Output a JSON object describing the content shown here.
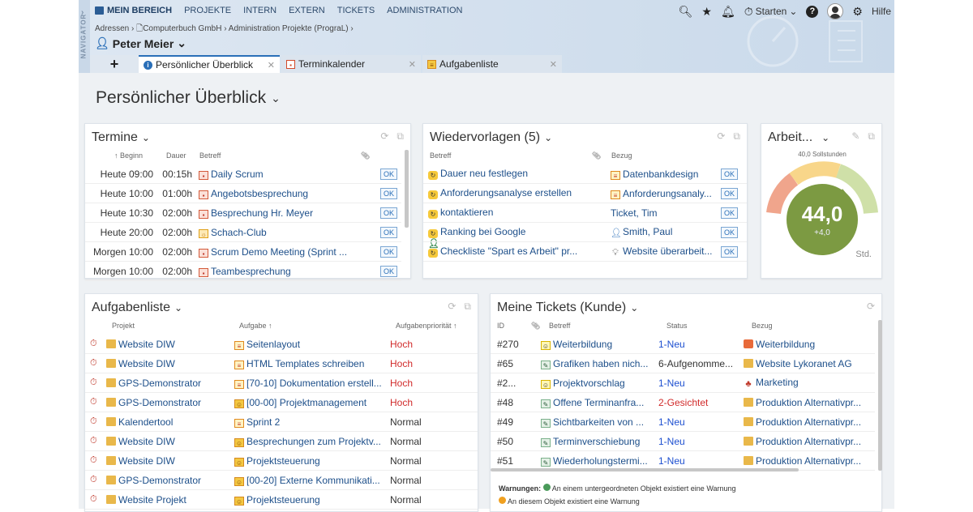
{
  "nav": {
    "vertical_label": "NAVIGATOR",
    "items": [
      "MEIN BEREICH",
      "PROJEKTE",
      "INTERN",
      "EXTERN",
      "TICKETS",
      "ADMINISTRATION"
    ]
  },
  "topright": {
    "start_label": "Starten",
    "help_label": "Hilfe"
  },
  "breadcrumb": [
    "Adressen",
    "Computerbuch GmbH",
    "Administration Projekte (PrograL)"
  ],
  "user": {
    "name": "Peter Meier"
  },
  "tabs": [
    {
      "label": "Persönlicher Überblick",
      "icon": "info-icon"
    },
    {
      "label": "Terminkalender",
      "icon": "calendar-icon"
    },
    {
      "label": "Aufgabenliste",
      "icon": "task-icon"
    }
  ],
  "page_title": "Persönlicher Überblick",
  "termine": {
    "title": "Termine",
    "headers": [
      "↑ Beginn",
      "Dauer",
      "Betreff"
    ],
    "rows": [
      {
        "begin": "Heute 09:00",
        "dauer": "00:15h",
        "betreff": "Daily Scrum",
        "icon": "cal",
        "ok": "OK"
      },
      {
        "begin": "Heute 10:00",
        "dauer": "01:00h",
        "betreff": "Angebotsbesprechung",
        "icon": "cal",
        "ok": "OK"
      },
      {
        "begin": "Heute 10:30",
        "dauer": "02:00h",
        "betreff": "Besprechung Hr. Meyer",
        "icon": "cal",
        "ok": "OK"
      },
      {
        "begin": "Heute 20:00",
        "dauer": "02:00h",
        "betreff": "Schach-Club",
        "icon": "club",
        "ok": "OK"
      },
      {
        "begin": "Morgen 10:00",
        "dauer": "02:00h",
        "betreff": "Scrum Demo Meeting (Sprint ...",
        "icon": "cal",
        "ok": "OK"
      },
      {
        "begin": "Morgen 10:00",
        "dauer": "02:00h",
        "betreff": "Teambesprechung",
        "icon": "cal",
        "ok": "OK"
      }
    ]
  },
  "wiedervorlagen": {
    "title": "Wiedervorlagen (5)",
    "headers": [
      "Betreff",
      "Bezug"
    ],
    "rows": [
      {
        "betreff": "Dauer neu festlegen",
        "bezug": "Datenbankdesign",
        "bezug_icon": "task",
        "ok": "OK"
      },
      {
        "betreff": "Anforderungsanalyse erstellen",
        "bezug": "Anforderungsanaly...",
        "bezug_icon": "task",
        "ok": "OK"
      },
      {
        "betreff": "kontaktieren",
        "bezug": "Ticket, Tim",
        "bezug_icon": "user",
        "ok": "OK"
      },
      {
        "betreff": "Ranking bei Google",
        "bezug": "Smith, Paul",
        "bezug_icon": "userb",
        "ok": "OK"
      },
      {
        "betreff": "Checkliste \"Spart es Arbeit\" pr...",
        "bezug": "Website überarbeit...",
        "bezug_icon": "bulb",
        "ok": "OK"
      }
    ]
  },
  "arbeit": {
    "title": "Arbeit...",
    "soll_label": "40,0 Sollstunden",
    "value": "44,0",
    "delta": "+4,0",
    "unit": "Std.",
    "value_num": 44,
    "soll_num": 40
  },
  "aufgaben": {
    "title": "Aufgabenliste",
    "headers": [
      "Projekt",
      "Aufgabe ↑",
      "Aufgabenpriorität ↑"
    ],
    "rows": [
      {
        "projekt": "Website DIW",
        "aufgabe": "Seitenlayout",
        "prio": "Hoch",
        "icon": "task"
      },
      {
        "projekt": "Website DIW",
        "aufgabe": "HTML Templates schreiben",
        "prio": "Hoch",
        "icon": "task"
      },
      {
        "projekt": "GPS-Demonstrator",
        "aufgabe": "[70-10] Dokumentation erstell...",
        "prio": "Hoch",
        "icon": "task"
      },
      {
        "projekt": "GPS-Demonstrator",
        "aufgabe": "[00-00] Projektmanagement",
        "prio": "Hoch",
        "icon": "proj"
      },
      {
        "projekt": "Kalendertool",
        "aufgabe": "Sprint 2",
        "prio": "Normal",
        "icon": "task"
      },
      {
        "projekt": "Website DIW",
        "aufgabe": "Besprechungen zum Projektv...",
        "prio": "Normal",
        "icon": "proj"
      },
      {
        "projekt": "Website DIW",
        "aufgabe": "Projektsteuerung",
        "prio": "Normal",
        "icon": "proj"
      },
      {
        "projekt": "GPS-Demonstrator",
        "aufgabe": "[00-20] Externe Kommunikati...",
        "prio": "Normal",
        "icon": "proj"
      },
      {
        "projekt": "Website Projekt",
        "aufgabe": "Projektsteuerung",
        "prio": "Normal",
        "icon": "proj"
      }
    ]
  },
  "tickets": {
    "title": "Meine Tickets (Kunde)",
    "headers": [
      "ID",
      "Betreff",
      "Status",
      "Bezug"
    ],
    "rows": [
      {
        "id": "#270",
        "betreff": "Weiterbildung",
        "status": "1-Neu",
        "status_color": "blue",
        "bezug": "Weiterbildung",
        "ticon": "tick",
        "bicon": "cube"
      },
      {
        "id": "#65",
        "betreff": "Grafiken haben nich...",
        "status": "6-Aufgenomme...",
        "status_color": "dark",
        "bezug": "Website Lykoranet AG",
        "ticon": "tickg",
        "bicon": "folder"
      },
      {
        "id": "#2...",
        "betreff": "Projektvorschlag",
        "status": "1-Neu",
        "status_color": "blue",
        "bezug": "Marketing",
        "ticon": "tick",
        "bicon": "mkt"
      },
      {
        "id": "#48",
        "betreff": "Offene Terminanfra...",
        "status": "2-Gesichtet",
        "status_color": "red",
        "bezug": "Produktion Alternativpr...",
        "ticon": "tickg",
        "bicon": "folder"
      },
      {
        "id": "#49",
        "betreff": "Sichtbarkeiten von ...",
        "status": "1-Neu",
        "status_color": "blue",
        "bezug": "Produktion Alternativpr...",
        "ticon": "tickg",
        "bicon": "folder"
      },
      {
        "id": "#50",
        "betreff": "Terminverschiebung",
        "status": "1-Neu",
        "status_color": "blue",
        "bezug": "Produktion Alternativpr...",
        "ticon": "tickg",
        "bicon": "folder"
      },
      {
        "id": "#51",
        "betreff": "Wiederholungstermi...",
        "status": "1-Neu",
        "status_color": "blue",
        "bezug": "Produktion Alternativpr...",
        "ticon": "tickg",
        "bicon": "folder"
      }
    ],
    "warn_label": "Warnungen:",
    "warn1": "An einem untergeordneten Objekt existiert eine Warnung",
    "warn2": "An diesem Objekt existiert eine Warnung"
  }
}
